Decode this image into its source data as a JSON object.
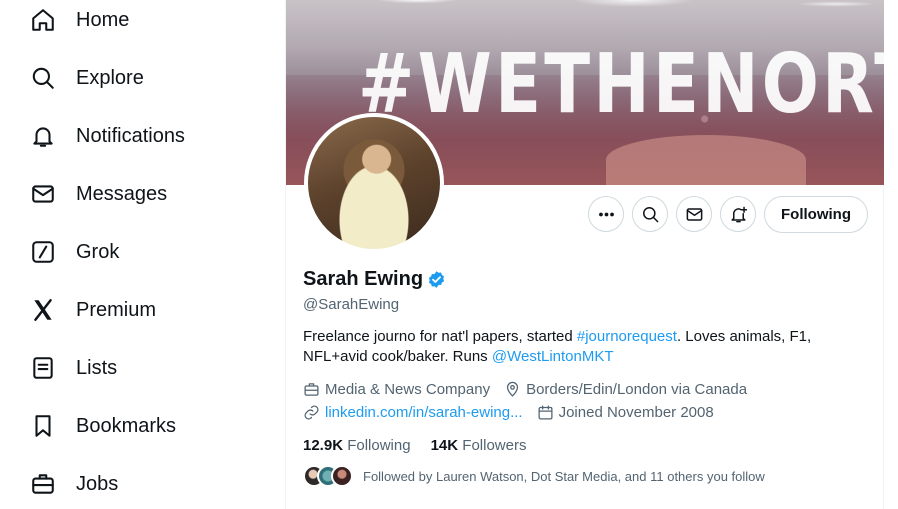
{
  "sidebar": {
    "items": [
      {
        "label": "Home",
        "icon": "home-icon"
      },
      {
        "label": "Explore",
        "icon": "search-icon"
      },
      {
        "label": "Notifications",
        "icon": "bell-icon"
      },
      {
        "label": "Messages",
        "icon": "envelope-icon"
      },
      {
        "label": "Grok",
        "icon": "grok-icon"
      },
      {
        "label": "Premium",
        "icon": "x-logo-icon"
      },
      {
        "label": "Lists",
        "icon": "list-icon"
      },
      {
        "label": "Bookmarks",
        "icon": "bookmark-icon"
      },
      {
        "label": "Jobs",
        "icon": "briefcase-icon"
      }
    ]
  },
  "profile": {
    "banner_text": "#WETHENORTH",
    "name": "Sarah Ewing",
    "handle": "@SarahEwing",
    "verified": true,
    "follow_button_label": "Following",
    "bio": {
      "part1": "Freelance journo for nat'l papers, started ",
      "hashtag": "#journorequest",
      "part2": ". Loves animals, F1, NFL+avid cook/baker. Runs ",
      "mention": "@WestLintonMKT"
    },
    "category": "Media & News Company",
    "location": "Borders/Edin/London via Canada",
    "website": "linkedin.com/in/sarah-ewing...",
    "joined": "Joined November 2008",
    "following_count": "12.9K",
    "following_label": "Following",
    "followers_count": "14K",
    "followers_label": "Followers",
    "followed_by": "Followed by Lauren Watson, Dot Star Media, and 11 others you follow"
  },
  "colors": {
    "accent": "#1d9bf0",
    "secondary_text": "#536471",
    "primary_text": "#0f1419",
    "border": "#cfd9de"
  }
}
